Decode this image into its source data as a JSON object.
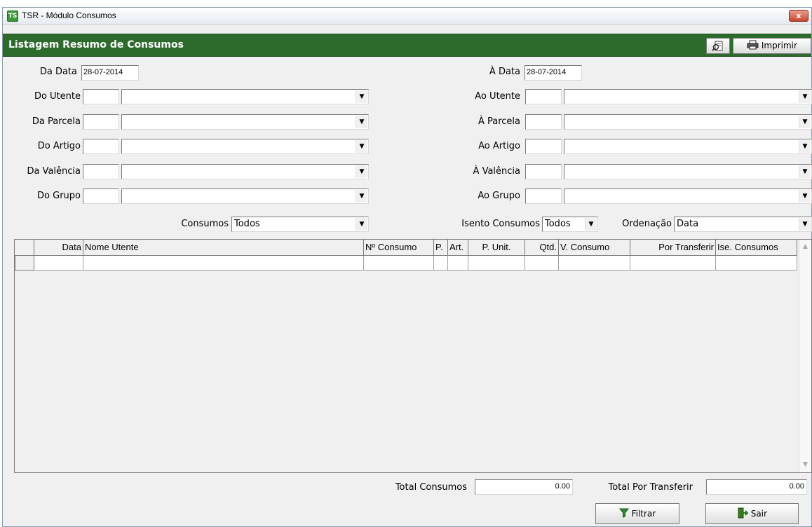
{
  "window": {
    "title": "TSR - Módulo Consumos",
    "close_label": "x"
  },
  "header": {
    "title": "Listagem Resumo de Consumos",
    "print_label": "Imprimir"
  },
  "filters": {
    "da_data_label": "Da Data",
    "da_data_value": "28-07-2014",
    "a_data_label": "À Data",
    "a_data_value": "28-07-2014",
    "rows": [
      {
        "left_label": "Do Utente",
        "right_label": "Ao Utente"
      },
      {
        "left_label": "Da Parcela",
        "right_label": "À Parcela"
      },
      {
        "left_label": "Do Artigo",
        "right_label": "Ao Artigo"
      },
      {
        "left_label": "Da Valência",
        "right_label": "À Valência"
      },
      {
        "left_label": "Do Grupo",
        "right_label": "Ao Grupo"
      }
    ],
    "consumos_label": "Consumos",
    "consumos_value": "Todos",
    "isento_label": "Isento Consumos",
    "isento_value": "Todos",
    "ordenacao_label": "Ordenação",
    "ordenacao_value": "Data"
  },
  "table": {
    "columns": [
      "Data",
      "Nome Utente",
      "Nº Consumo",
      "P.",
      "Art.",
      "P. Unit.",
      "Qtd.",
      "V. Consumo",
      "Por Transferir",
      "Ise. Consumos"
    ]
  },
  "totals": {
    "consumos_label": "Total Consumos",
    "consumos_value": "0.00",
    "transferir_label": "Total Por Transferir",
    "transferir_value": "0.00"
  },
  "buttons": {
    "filtrar": "Filtrar",
    "sair": "Sair"
  }
}
